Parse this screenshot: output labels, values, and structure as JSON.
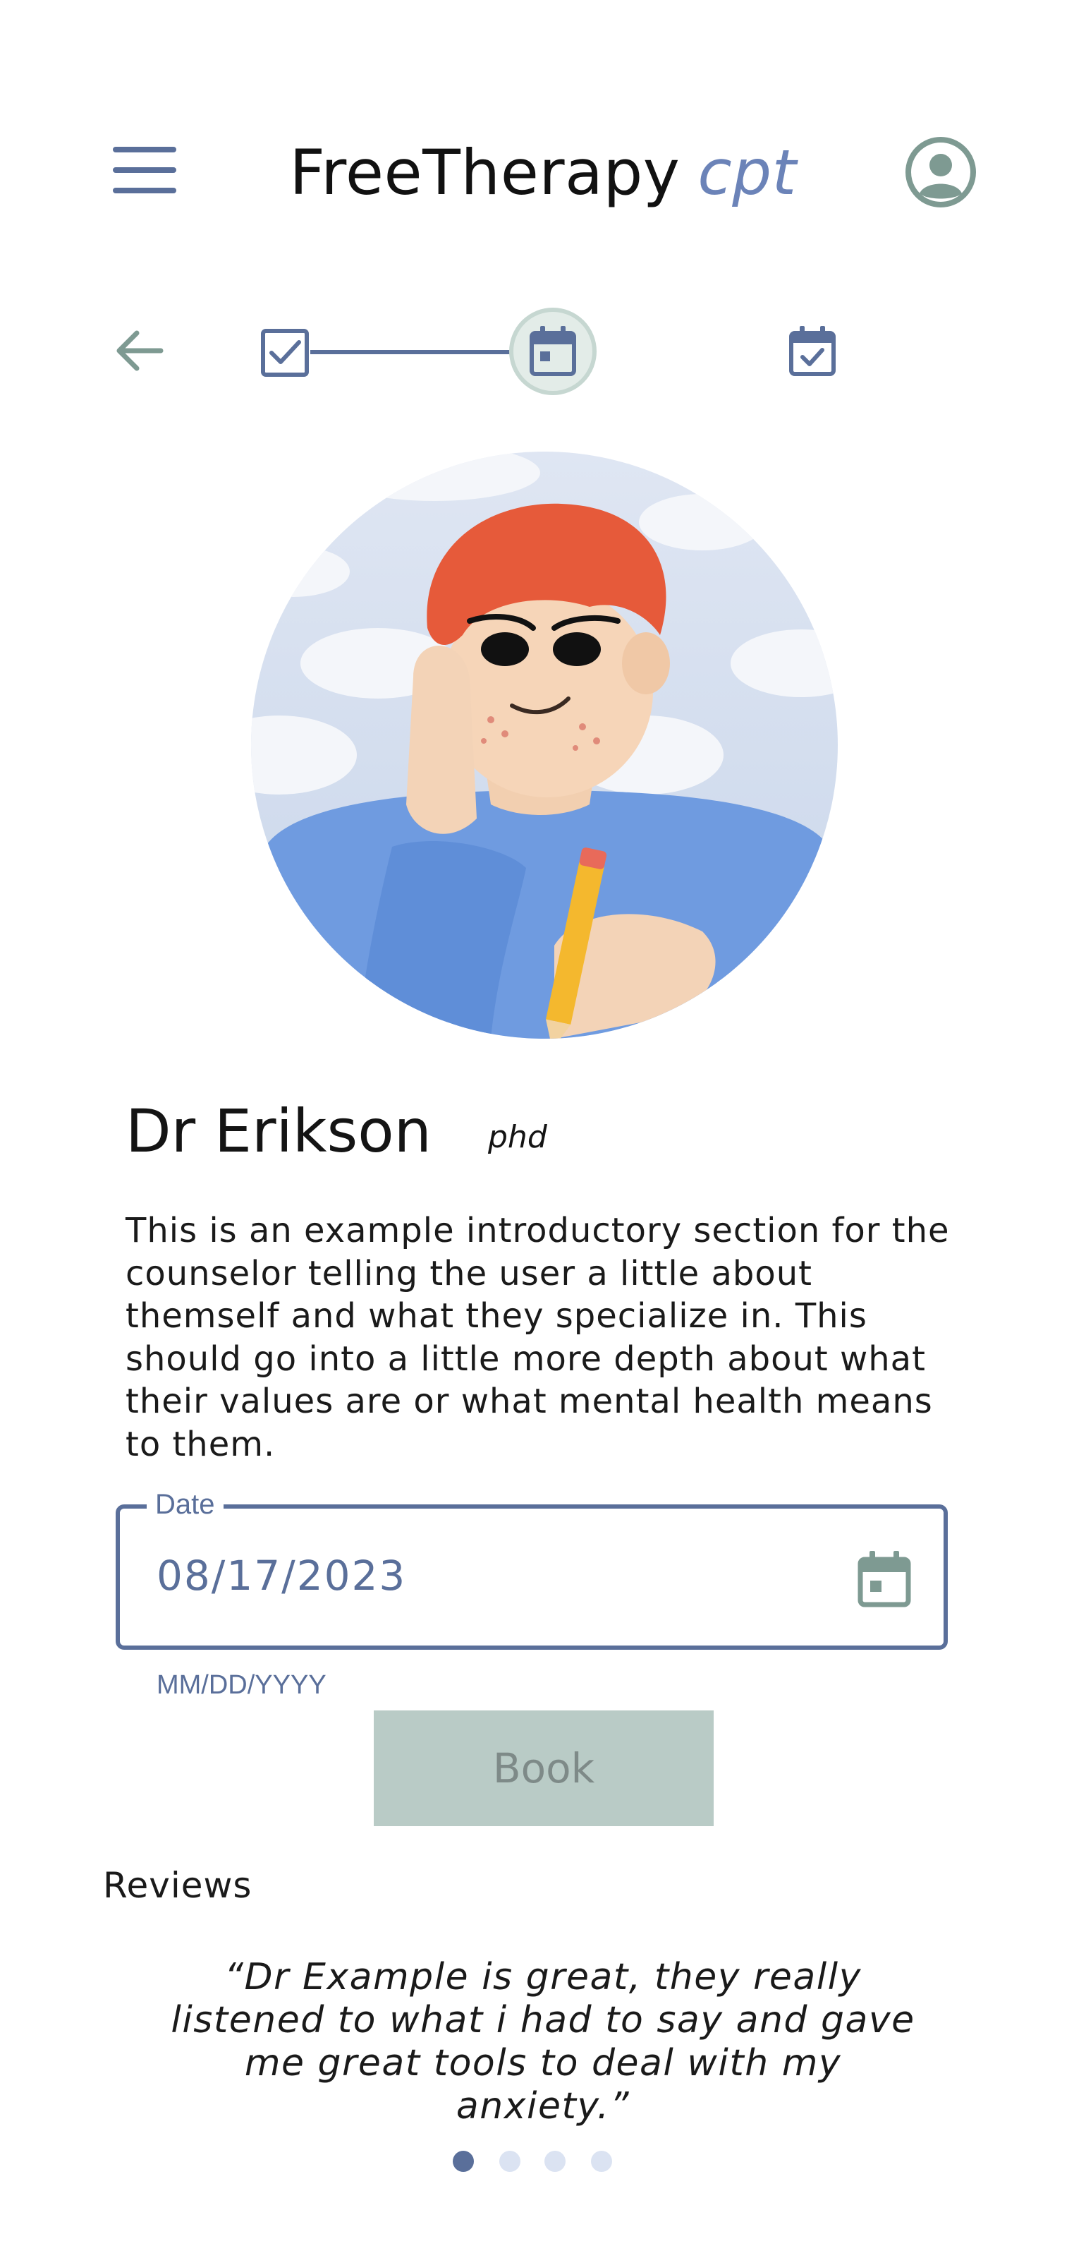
{
  "header": {
    "brand_main": "FreeTherapy",
    "brand_sub": "cpt",
    "icons": {
      "menu": "hamburger-menu-icon",
      "account": "account-circle-icon"
    }
  },
  "stepper": {
    "icons": [
      "back-arrow-icon",
      "checkbox-checked-icon",
      "calendar-icon",
      "calendar-check-icon"
    ],
    "active_step": 2
  },
  "counselor": {
    "name": "Dr Erikson",
    "degree": "phd",
    "bio": "This is an example introductory section for the counselor telling the user a little about themself and what they specialize in. This should go into a little more depth about what their values are or what mental health means to them."
  },
  "date_field": {
    "label": "Date",
    "value": "08/17/2023",
    "helper": "MM/DD/YYYY"
  },
  "book_button": {
    "label": "Book"
  },
  "reviews": {
    "title": "Reviews",
    "quote": "“Dr Example is great, they really listened to what i had to say and gave me great tools to deal with my anxiety.”",
    "total": 4,
    "active_index": 0
  },
  "colors": {
    "primary": "#5a6f9a",
    "teal": "#7e9a92",
    "brand_accent": "#6b83b8",
    "button_bg": "#b9cbc6",
    "button_text": "#7e8a88"
  }
}
